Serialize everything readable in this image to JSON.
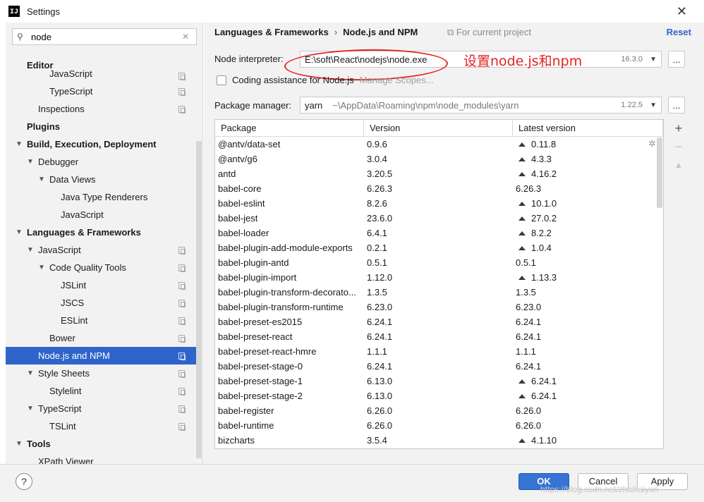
{
  "window": {
    "title": "Settings",
    "app_icon": "intellij-icon",
    "close_glyph": "✕"
  },
  "search": {
    "value": "node",
    "icon": "search-icon",
    "clear_glyph": "✕"
  },
  "tree": [
    {
      "label": "Editor",
      "depth": 1,
      "bold": true,
      "arrow": ""
    },
    {
      "label": "JavaScript",
      "depth": 3,
      "bold": false,
      "arrow": "",
      "partial": true,
      "copy": true
    },
    {
      "label": "TypeScript",
      "depth": 3,
      "bold": false,
      "arrow": "",
      "copy": true
    },
    {
      "label": "Inspections",
      "depth": 2,
      "bold": false,
      "arrow": "",
      "copy": true
    },
    {
      "label": "Plugins",
      "depth": 1,
      "bold": true,
      "arrow": ""
    },
    {
      "label": "Build, Execution, Deployment",
      "depth": 1,
      "bold": true,
      "arrow": "▼"
    },
    {
      "label": "Debugger",
      "depth": 2,
      "bold": false,
      "arrow": "▼"
    },
    {
      "label": "Data Views",
      "depth": 3,
      "bold": false,
      "arrow": "▼"
    },
    {
      "label": "Java Type Renderers",
      "depth": 4,
      "bold": false,
      "arrow": ""
    },
    {
      "label": "JavaScript",
      "depth": 4,
      "bold": false,
      "arrow": ""
    },
    {
      "label": "Languages & Frameworks",
      "depth": 1,
      "bold": true,
      "arrow": "▼"
    },
    {
      "label": "JavaScript",
      "depth": 2,
      "bold": false,
      "arrow": "▼",
      "copy": true
    },
    {
      "label": "Code Quality Tools",
      "depth": 3,
      "bold": false,
      "arrow": "▼",
      "copy": true
    },
    {
      "label": "JSLint",
      "depth": 4,
      "bold": false,
      "arrow": "",
      "copy": true
    },
    {
      "label": "JSCS",
      "depth": 4,
      "bold": false,
      "arrow": "",
      "copy": true
    },
    {
      "label": "ESLint",
      "depth": 4,
      "bold": false,
      "arrow": "",
      "copy": true
    },
    {
      "label": "Bower",
      "depth": 3,
      "bold": false,
      "arrow": "",
      "copy": true
    },
    {
      "label": "Node.js and NPM",
      "depth": 2,
      "bold": false,
      "arrow": "",
      "copy": true,
      "selected": true
    },
    {
      "label": "Style Sheets",
      "depth": 2,
      "bold": false,
      "arrow": "▼",
      "copy": true
    },
    {
      "label": "Stylelint",
      "depth": 3,
      "bold": false,
      "arrow": "",
      "copy": true
    },
    {
      "label": "TypeScript",
      "depth": 2,
      "bold": false,
      "arrow": "▼",
      "copy": true
    },
    {
      "label": "TSLint",
      "depth": 3,
      "bold": false,
      "arrow": "",
      "copy": true
    },
    {
      "label": "Tools",
      "depth": 1,
      "bold": true,
      "arrow": "▼"
    },
    {
      "label": "XPath Viewer",
      "depth": 2,
      "bold": false,
      "arrow": ""
    }
  ],
  "header": {
    "crumb1": "Languages & Frameworks",
    "crumb_sep": "›",
    "crumb2": "Node.js and NPM",
    "for_project": "For current project",
    "reset": "Reset"
  },
  "interpreter": {
    "label": "Node interpreter:",
    "value": "E:\\soft\\React\\nodejs\\node.exe",
    "version": "16.3.0",
    "dots": "...",
    "annotation": "设置node.js和npm"
  },
  "coding_assist": {
    "label": "Coding assistance for Node.js",
    "manage": "Manage Scopes..."
  },
  "package_manager": {
    "label": "Package manager:",
    "value": "yarn",
    "path": "~\\AppData\\Roaming\\npm\\node_modules\\yarn",
    "version": "1.22.5",
    "dots": "..."
  },
  "table": {
    "headers": [
      "Package",
      "Version",
      "Latest version"
    ],
    "rows": [
      {
        "pkg": "@antv/data-set",
        "ver": "0.9.6",
        "latest": "0.11.8",
        "upgrade": true
      },
      {
        "pkg": "@antv/g6",
        "ver": "3.0.4",
        "latest": "4.3.3",
        "upgrade": true
      },
      {
        "pkg": "antd",
        "ver": "3.20.5",
        "latest": "4.16.2",
        "upgrade": true
      },
      {
        "pkg": "babel-core",
        "ver": "6.26.3",
        "latest": "6.26.3",
        "upgrade": false
      },
      {
        "pkg": "babel-eslint",
        "ver": "8.2.6",
        "latest": "10.1.0",
        "upgrade": true
      },
      {
        "pkg": "babel-jest",
        "ver": "23.6.0",
        "latest": "27.0.2",
        "upgrade": true
      },
      {
        "pkg": "babel-loader",
        "ver": "6.4.1",
        "latest": "8.2.2",
        "upgrade": true
      },
      {
        "pkg": "babel-plugin-add-module-exports",
        "ver": "0.2.1",
        "latest": "1.0.4",
        "upgrade": true
      },
      {
        "pkg": "babel-plugin-antd",
        "ver": "0.5.1",
        "latest": "0.5.1",
        "upgrade": false
      },
      {
        "pkg": "babel-plugin-import",
        "ver": "1.12.0",
        "latest": "1.13.3",
        "upgrade": true
      },
      {
        "pkg": "babel-plugin-transform-decorato...",
        "ver": "1.3.5",
        "latest": "1.3.5",
        "upgrade": false
      },
      {
        "pkg": "babel-plugin-transform-runtime",
        "ver": "6.23.0",
        "latest": "6.23.0",
        "upgrade": false
      },
      {
        "pkg": "babel-preset-es2015",
        "ver": "6.24.1",
        "latest": "6.24.1",
        "upgrade": false
      },
      {
        "pkg": "babel-preset-react",
        "ver": "6.24.1",
        "latest": "6.24.1",
        "upgrade": false
      },
      {
        "pkg": "babel-preset-react-hmre",
        "ver": "1.1.1",
        "latest": "1.1.1",
        "upgrade": false
      },
      {
        "pkg": "babel-preset-stage-0",
        "ver": "6.24.1",
        "latest": "6.24.1",
        "upgrade": false
      },
      {
        "pkg": "babel-preset-stage-1",
        "ver": "6.13.0",
        "latest": "6.24.1",
        "upgrade": true
      },
      {
        "pkg": "babel-preset-stage-2",
        "ver": "6.13.0",
        "latest": "6.24.1",
        "upgrade": true
      },
      {
        "pkg": "babel-register",
        "ver": "6.26.0",
        "latest": "6.26.0",
        "upgrade": false
      },
      {
        "pkg": "babel-runtime",
        "ver": "6.26.0",
        "latest": "6.26.0",
        "upgrade": false
      },
      {
        "pkg": "bizcharts",
        "ver": "3.5.4",
        "latest": "4.1.10",
        "upgrade": true
      }
    ]
  },
  "side_tools": {
    "add": "+",
    "remove": "−",
    "upgrade": "▲"
  },
  "footer": {
    "help": "?",
    "ok": "OK",
    "cancel": "Cancel",
    "apply": "Apply",
    "watermark": "https://blog.csdn.net/zhaikaiyun"
  },
  "colors": {
    "accent": "#2f65ca",
    "annotation": "#e52222",
    "ok_button": "#3574d4"
  }
}
